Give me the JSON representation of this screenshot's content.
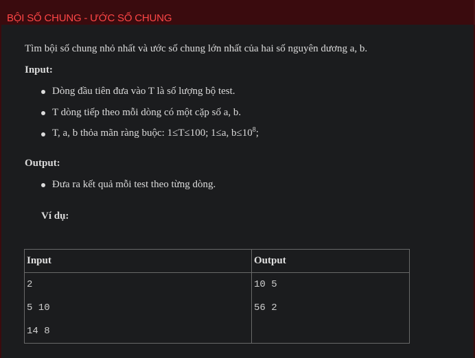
{
  "header": {
    "title": "BỘI SỐ CHUNG - ƯỚC SỐ CHUNG"
  },
  "problem": {
    "statement": "Tìm bội số chung nhỏ nhất và ước số chung lớn nhất của hai số nguyên dương a, b.",
    "input_label": "Input:",
    "input_items": [
      "Dòng đầu tiên đưa vào T là số lượng bộ test.",
      "T dòng tiếp theo mỗi dòng có một cặp số a, b.",
      "T, a, b thỏa mãn ràng buộc: 1≤T≤100; 1≤a, b≤10"
    ],
    "input_item3_sup": "8",
    "input_item3_end": ";",
    "output_label": "Output:",
    "output_items": [
      "Đưa ra kết quả mỗi test theo từng dòng."
    ],
    "example_label": "Ví dụ:"
  },
  "example_table": {
    "headers": [
      "Input",
      "Output"
    ],
    "input_lines": [
      "2",
      "5 10",
      "14 8"
    ],
    "output_lines": [
      "10 5",
      "56 2"
    ]
  },
  "colors": {
    "title": "#ff4646",
    "header_bg": "#3a0b0e",
    "content_bg": "#1b1c1e"
  }
}
